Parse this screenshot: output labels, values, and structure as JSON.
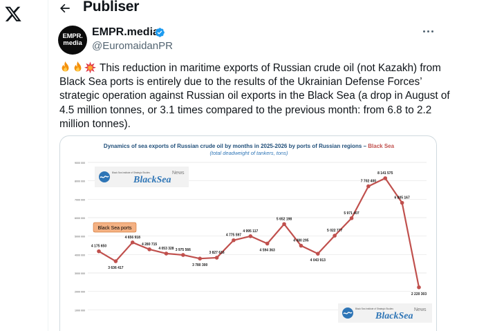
{
  "page": {
    "title": "Publiser"
  },
  "tweet": {
    "author_name": "EMPR.media",
    "handle": "@EuromaidanPR",
    "avatar_text": [
      "EMPR.",
      "media"
    ],
    "text": "This reduction in maritime exports of Russian crude oil (not Kazakh) from Black Sea ports is entirely due to the results of the Ukrainian Defense Forces’ strategic operation against Russian oil exports in the Black Sea (a drop in August of 4.5 million tonnes, or 3.1 times compared to the previous month: from 6.8 to 2.2 million tonnes).",
    "emojis": [
      "fire-emoji",
      "fire-emoji",
      "explosion-emoji"
    ]
  },
  "icons": {
    "logo": "x-logo-icon",
    "back": "back-arrow-icon",
    "verified": "verified-badge-icon",
    "more": "more-horizontal-icon"
  },
  "colors": {
    "accent": "#1d9bf0",
    "series": "#c0504d",
    "legend_bg": "#f4b183",
    "title_blue": "#1f4e79"
  },
  "chart_data": {
    "type": "line",
    "title": "Dynamics of sea exports of Russian crude oil by months in 2025-2026 by ports of Russian regions – ",
    "title_highlight": "Black Sea",
    "subtitle": "(total deadweight of tankers, tons)",
    "legend": "Black Sea ports",
    "watermark_name": "BlackSea",
    "watermark_news": "News",
    "watermark_institute": "Black Sea Institute of Strategic Studies",
    "ylim": [
      0,
      9000000
    ],
    "y_ticks": [
      "9000 000",
      "8000 000",
      "7000 000",
      "6000 000",
      "5000 000",
      "4000 000",
      "3000 000",
      "2000 000",
      "1000 000"
    ],
    "grid": true,
    "series": [
      {
        "values": [
          4175650,
          3636417,
          4656918,
          4280715,
          4053328,
          3975566,
          3780300,
          3827616,
          4775597,
          4995117,
          4594363,
          5652198,
          4480295,
          4043913,
          5022777,
          5971407,
          7702400,
          8141575,
          6805167,
          2220303
        ],
        "labels": [
          "4 175 650",
          "3 636 417",
          "4 656 918",
          "4 280 715",
          "4 053 328",
          "3 975 566",
          "3 780 300",
          "3 827 616",
          "4 775 597",
          "4 995 117",
          "4 594 363",
          "5 652 198",
          "4 480 295",
          "4 043 913",
          "5 022 777",
          "5 971 407",
          "7 702 400",
          "8 141 575",
          "6 805 167",
          "2 220 303"
        ]
      }
    ]
  }
}
